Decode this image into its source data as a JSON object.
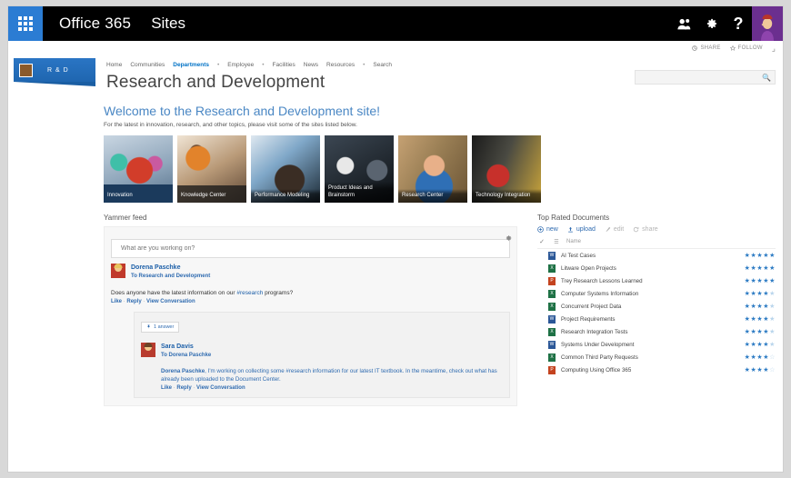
{
  "suite": {
    "waffle": "app-launcher",
    "brand": "Office 365",
    "app": "Sites",
    "icons": {
      "people": "people-icon",
      "settings": "gear-icon",
      "help": "?"
    }
  },
  "topstrip": {
    "share": "SHARE",
    "follow": "FOLLOW",
    "focus": "focus-on-content-icon"
  },
  "site": {
    "logo_text": "R & D",
    "title": "Research and Development",
    "nav": [
      {
        "label": "Home",
        "selected": false,
        "dot": false
      },
      {
        "label": "Communities",
        "selected": false,
        "dot": false
      },
      {
        "label": "Departments",
        "selected": true,
        "dot": false
      },
      {
        "label": "•",
        "selected": false,
        "dot": true
      },
      {
        "label": "Employee",
        "selected": false,
        "dot": false
      },
      {
        "label": "•",
        "selected": false,
        "dot": true
      },
      {
        "label": "Facilities",
        "selected": false,
        "dot": false
      },
      {
        "label": "News",
        "selected": false,
        "dot": false
      },
      {
        "label": "Resources",
        "selected": false,
        "dot": false
      },
      {
        "label": "•",
        "selected": false,
        "dot": true
      },
      {
        "label": "Search",
        "selected": false,
        "dot": false
      }
    ],
    "search_placeholder": "",
    "search_value": ""
  },
  "welcome": {
    "title": "Welcome to the Research and Development site!",
    "subtitle": "For the latest in innovation, research, and other topics, please visit some of the sites listed below."
  },
  "tiles": [
    {
      "caption": "Innovation"
    },
    {
      "caption": "Knowledge Center"
    },
    {
      "caption": "Performance Modeling"
    },
    {
      "caption": "Product Ideas and Brainstorm"
    },
    {
      "caption": "Research Center"
    },
    {
      "caption": "Technology Integration"
    }
  ],
  "yammer": {
    "heading": "Yammer feed",
    "gear": "gear-icon",
    "compose_placeholder": "What are you working on?",
    "post": {
      "author": "Dorena Paschke",
      "to": "To Research and Development",
      "body_pre": "Does anyone have the latest information on our ",
      "body_tag": "#research",
      "body_post": " programs?",
      "actions": {
        "like": "Like",
        "reply": "Reply",
        "view": "View Conversation"
      }
    },
    "reply": {
      "badge": "1 answer",
      "author": "Sara Davis",
      "to": "To Dorena Paschke",
      "mention": "Dorena Paschke",
      "body": ", I'm working on collecting some #research information for our latest IT textbook. In the meantime, check out what has already been uploaded to the Document Center.",
      "actions": {
        "like": "Like",
        "reply": "Reply",
        "view": "View Conversation"
      }
    }
  },
  "documents": {
    "heading": "Top Rated Documents",
    "commands": [
      {
        "label": "new",
        "icon": "plus-circle-icon",
        "enabled": true
      },
      {
        "label": "upload",
        "icon": "upload-icon",
        "enabled": true
      },
      {
        "label": "edit",
        "icon": "pencil-icon",
        "enabled": false
      },
      {
        "label": "share",
        "icon": "share-icon",
        "enabled": false
      }
    ],
    "column_header": "Name",
    "rows": [
      {
        "name": "AI Test Cases",
        "type": "doc",
        "color": "#2b5797",
        "glyph": "W",
        "stars": 5,
        "half": false
      },
      {
        "name": "Litware Open Projects",
        "type": "sheet",
        "color": "#1e7145",
        "glyph": "X",
        "stars": 5,
        "half": false
      },
      {
        "name": "Trey Research Lessons Learned",
        "type": "slide",
        "color": "#c4431f",
        "glyph": "P",
        "stars": 5,
        "half": false
      },
      {
        "name": "Computer Systems Information",
        "type": "sheet",
        "color": "#1e7145",
        "glyph": "X",
        "stars": 4,
        "half": true
      },
      {
        "name": "Concurrent Project Data",
        "type": "sheet",
        "color": "#1e7145",
        "glyph": "X",
        "stars": 4,
        "half": true
      },
      {
        "name": "Project Requirements",
        "type": "doc",
        "color": "#2b5797",
        "glyph": "W",
        "stars": 4,
        "half": true
      },
      {
        "name": "Research Integration Tests",
        "type": "sheet",
        "color": "#1e7145",
        "glyph": "X",
        "stars": 4,
        "half": true
      },
      {
        "name": "Systems Under Development",
        "type": "doc",
        "color": "#2b5797",
        "glyph": "W",
        "stars": 4,
        "half": true
      },
      {
        "name": "Common Third Party Requests",
        "type": "sheet",
        "color": "#1e7145",
        "glyph": "X",
        "stars": 4,
        "half": false
      },
      {
        "name": "Computing Using Office 365",
        "type": "slide",
        "color": "#c4431f",
        "glyph": "P",
        "stars": 3,
        "half": true
      }
    ]
  },
  "colors": {
    "suite_bar": "#000000",
    "waffle": "#2b7cd3",
    "accent_link": "#0072c6",
    "heading_blue": "#4a87c4",
    "star": "#2e7cc4",
    "avatar_tile": "#6b2f8f"
  }
}
